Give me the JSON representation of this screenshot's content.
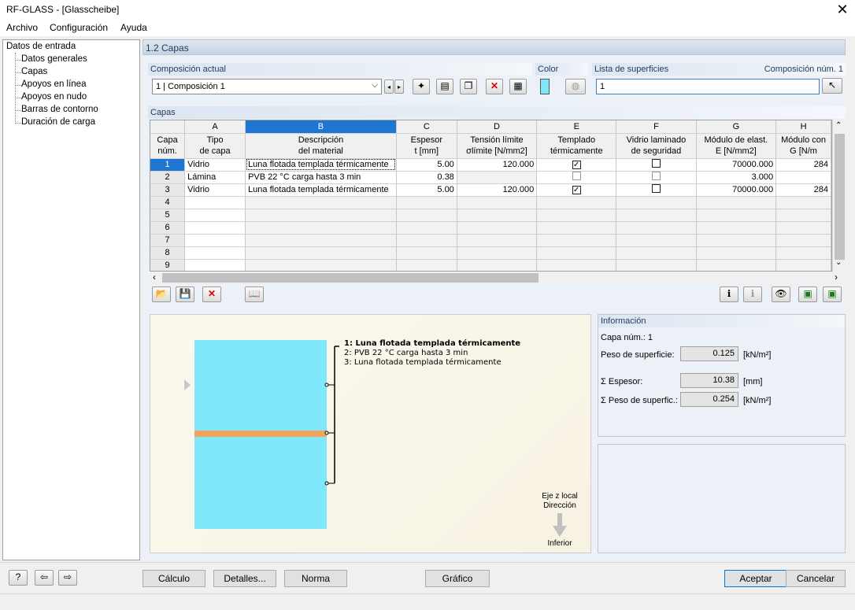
{
  "window": {
    "title": "RF-GLASS - [Glasscheibe]"
  },
  "menu": [
    "Archivo",
    "Configuración",
    "Ayuda"
  ],
  "nav": {
    "root": "Datos de entrada",
    "items": [
      "Datos generales",
      "Capas",
      "Apoyos en línea",
      "Apoyos en nudo",
      "Barras de contorno",
      "Duración de carga"
    ]
  },
  "section_title": "1.2 Capas",
  "composition": {
    "label": "Composición actual",
    "value": "1 | Composición 1"
  },
  "color_label": "Color",
  "surfaces": {
    "label": "Lista de superficies",
    "comp_label": "Composición núm. 1",
    "value": "1"
  },
  "layers_label": "Capas",
  "table": {
    "col_letters": [
      "A",
      "B",
      "C",
      "D",
      "E",
      "F",
      "G",
      "H"
    ],
    "rowhdr1": "Capa",
    "rowhdr2": "núm.",
    "headers1": [
      "Tipo",
      "Descripción",
      "Espesor",
      "Tensión límite",
      "Templado",
      "Vidrio laminado",
      "Módulo de elast.",
      "Módulo con"
    ],
    "headers2": [
      "de capa",
      "del material",
      "t [mm]",
      "σlímite [N/mm2]",
      "térmicamente",
      "de seguridad",
      "E [N/mm2]",
      "G [N/m"
    ],
    "rows": [
      {
        "num": "1",
        "type": "Vidrio",
        "desc": "Luna flotada templada térmicamente",
        "t": "5.00",
        "sigma": "120.000",
        "temp": "checked",
        "lam": "unchecked",
        "E": "70000.000",
        "G": "284"
      },
      {
        "num": "2",
        "type": "Lámina",
        "desc": "PVB 22 °C carga hasta 3 min",
        "t": "0.38",
        "sigma": "",
        "temp": "grey",
        "lam": "grey",
        "E": "3.000",
        "G": ""
      },
      {
        "num": "3",
        "type": "Vidrio",
        "desc": "Luna flotada templada térmicamente",
        "t": "5.00",
        "sigma": "120.000",
        "temp": "checked",
        "lam": "unchecked",
        "E": "70000.000",
        "G": "284"
      },
      {
        "num": "4"
      },
      {
        "num": "5"
      },
      {
        "num": "6"
      },
      {
        "num": "7"
      },
      {
        "num": "8"
      },
      {
        "num": "9"
      }
    ]
  },
  "preview": {
    "legend": [
      "1: Luna flotada templada térmicamente",
      "2: PVB 22 °C carga hasta 3 min",
      "3: Luna flotada templada térmicamente"
    ],
    "dir1": "Eje z local",
    "dir2": "Dirección",
    "dir3": "Inferior",
    "glass_color": "#7fe9fb",
    "film_color": "#f5a35a"
  },
  "info": {
    "title": "Información",
    "layer": "Capa núm.: 1",
    "weight_label": "Peso de superficie:",
    "weight_value": "0.125",
    "weight_unit": "[kN/m²]",
    "thick_label": "Σ Espesor:",
    "thick_value": "10.38",
    "thick_unit": "[mm]",
    "tweight_label": "Σ Peso de superfic.:",
    "tweight_value": "0.254",
    "tweight_unit": "[kN/m²]"
  },
  "buttons": {
    "calc": "Cálculo",
    "details": "Detalles...",
    "norm": "Norma",
    "graphic": "Gráfico",
    "accept": "Aceptar",
    "cancel": "Cancelar"
  },
  "colors": {
    "accent": "#1e76d2",
    "header_text": "#1f3a5a"
  }
}
